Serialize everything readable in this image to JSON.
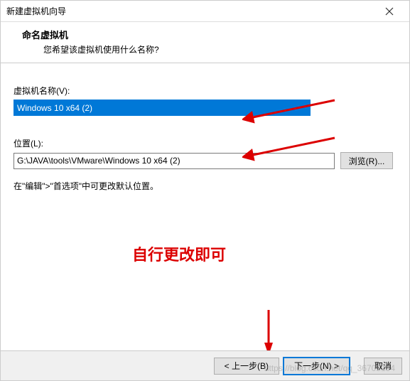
{
  "titlebar": {
    "title": "新建虚拟机向导"
  },
  "header": {
    "title": "命名虚拟机",
    "subtitle": "您希望该虚拟机使用什么名称?"
  },
  "fields": {
    "name_label": "虚拟机名称(V):",
    "name_value": "Windows 10 x64 (2)",
    "location_label": "位置(L):",
    "location_value": "G:\\JAVA\\tools\\VMware\\Windows 10 x64 (2)",
    "browse_label": "浏览(R)..."
  },
  "hint": "在\"编辑\">\"首选项\"中可更改默认位置。",
  "annotation": "自行更改即可",
  "footer": {
    "back": "< 上一步(B)",
    "next": "下一步(N) >",
    "cancel": "取消"
  },
  "watermark": "https://blog.csdn.net/qq_36705134"
}
